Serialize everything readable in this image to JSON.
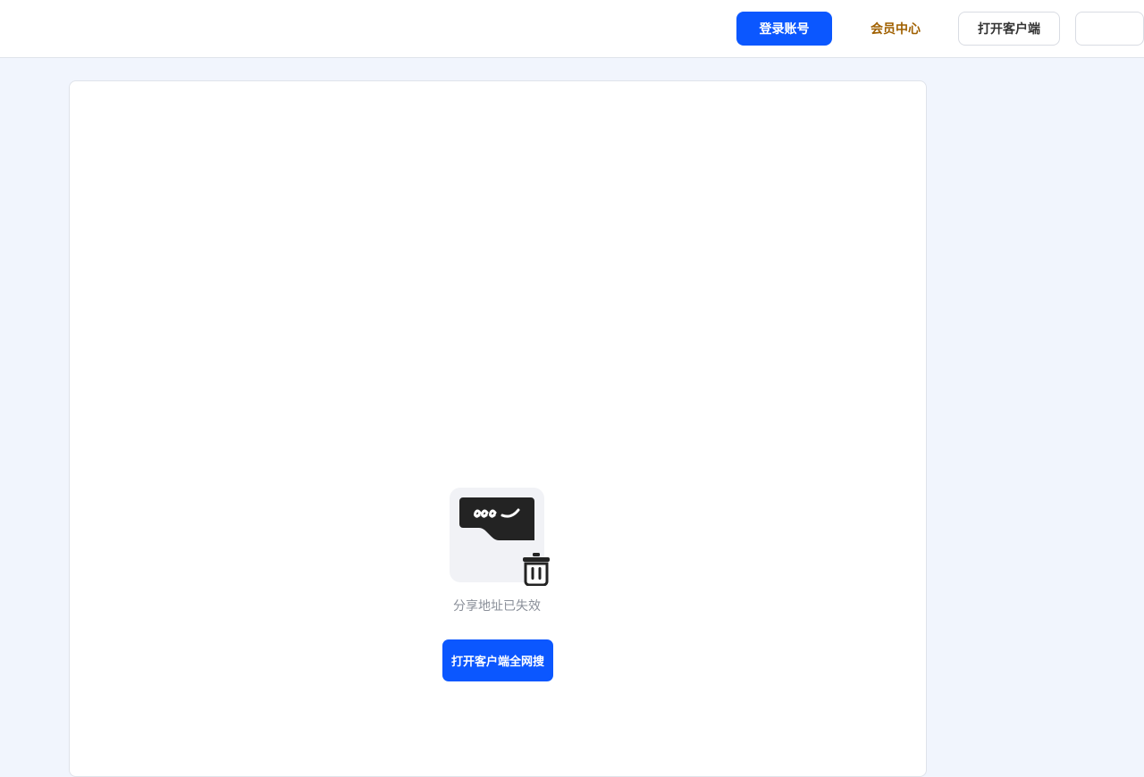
{
  "header": {
    "login_label": "登录账号",
    "member_label": "会员中心",
    "open_client_label": "打开客户端"
  },
  "main": {
    "empty_icon": "expired-link-icon",
    "trash_icon": "trash-icon",
    "message": "分享地址已失效",
    "cta_label": "打开客户端全网搜"
  },
  "colors": {
    "accent": "#0b57ff",
    "member_text": "#a06000",
    "page_bg": "#f1f5fd",
    "muted_text": "#8a8f99"
  }
}
